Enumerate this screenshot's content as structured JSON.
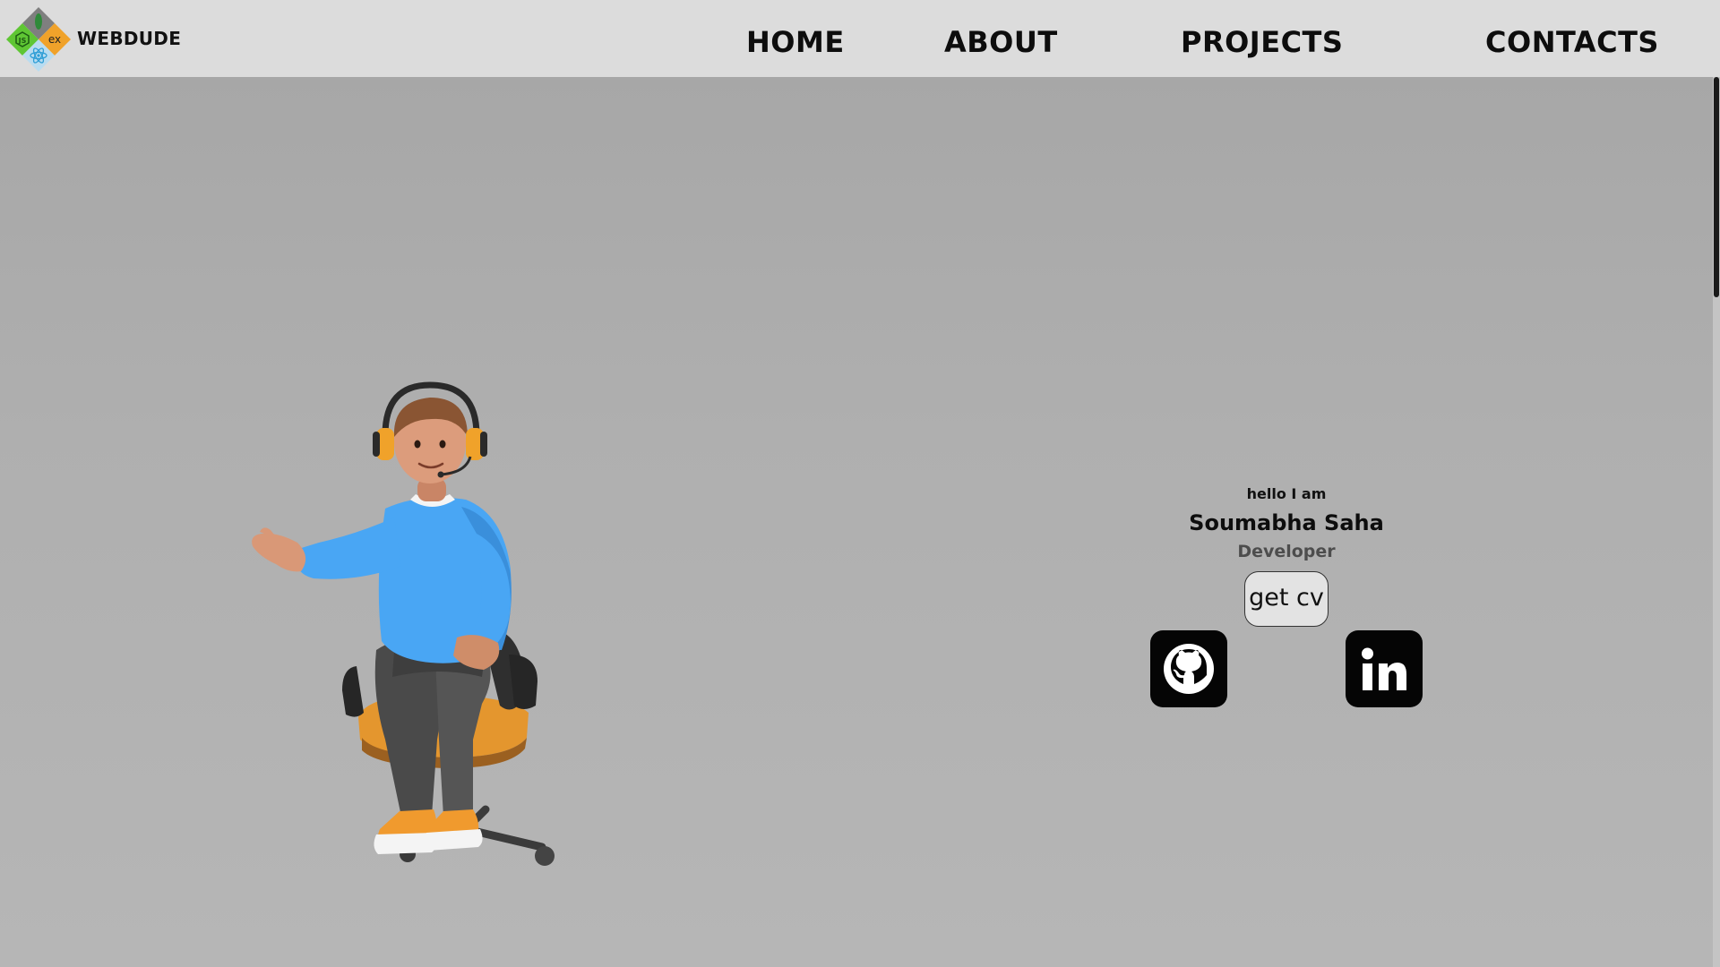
{
  "brand": {
    "name": "WEBDUDE",
    "logo_marks": [
      "JS",
      "ex"
    ]
  },
  "nav": {
    "items": [
      {
        "label": "HOME"
      },
      {
        "label": "ABOUT"
      },
      {
        "label": "PROJECTS"
      },
      {
        "label": "CONTACTS"
      }
    ]
  },
  "hero": {
    "greeting": "hello I am",
    "name": "Soumabha Saha",
    "role": "Developer",
    "cv_button_label": "get cv",
    "avatar_icon": "developer-avatar-illustration"
  },
  "social": {
    "github_icon": "github-icon",
    "linkedin_icon": "linkedin-icon"
  },
  "colors": {
    "header_bg": "#dcdcdc",
    "page_bg": "#b3b3b3",
    "text": "#0d0d0d",
    "role_text": "#4d4d4d",
    "social_bg": "#050505",
    "avatar_sweater": "#4aa8f5",
    "avatar_accent": "#f2a13a"
  }
}
